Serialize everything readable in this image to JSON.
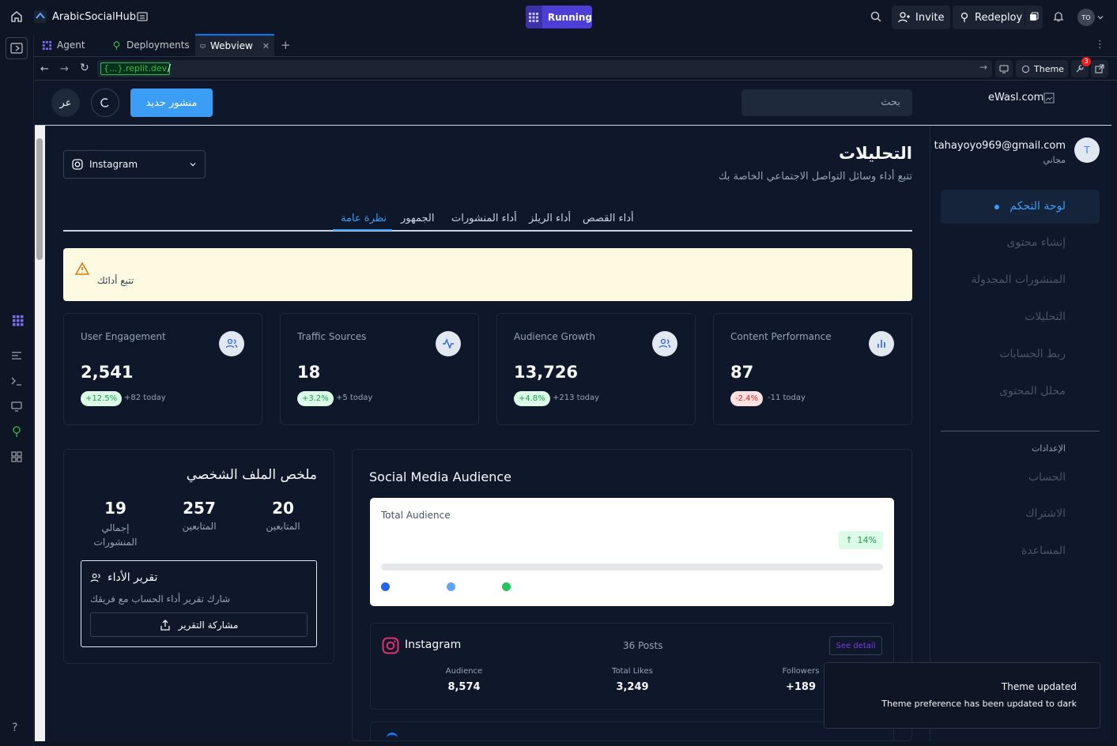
{
  "topbar": {
    "app_name": "ArabicSocialHub",
    "status": "Running",
    "invite": "Invite",
    "redeploy": "Redeploy",
    "avatar": "TO"
  },
  "tabs": [
    {
      "label": "Agent"
    },
    {
      "label": "Deployments"
    },
    {
      "label": "Webview"
    }
  ],
  "url": {
    "domain": "{...}.replit.dev",
    "path": "/",
    "theme": "Theme",
    "badge": "3"
  },
  "site": {
    "logo": "eWasl.com",
    "search_placeholder": "بحث",
    "new_post": "منشور جديد",
    "lang": "عر"
  },
  "user": {
    "email": "tahayoyo969@gmail.com",
    "plan": "مجاني",
    "initial": "T"
  },
  "sidebar": {
    "items": [
      {
        "label": "لوحة التحكم"
      },
      {
        "label": "إنشاء محتوى"
      },
      {
        "label": "المنشورات المجدولة"
      },
      {
        "label": "التحليلات"
      },
      {
        "label": "ربط الحسابات"
      },
      {
        "label": "محلل المحتوى"
      }
    ],
    "settings_title": "الإعدادات",
    "settings": [
      {
        "label": "الحساب"
      },
      {
        "label": "الاشتراك"
      },
      {
        "label": "المساعدة"
      }
    ]
  },
  "page": {
    "title": "التحليلات",
    "subtitle": "تتبع أداء وسائل التواصل الاجتماعي الخاصة بك",
    "platform": "Instagram"
  },
  "analytics_tabs": [
    {
      "label": "نظرة عامة"
    },
    {
      "label": "الجمهور"
    },
    {
      "label": "أداء المنشورات"
    },
    {
      "label": "أداء الريلز"
    },
    {
      "label": "أداء القصص"
    }
  ],
  "alert": {
    "text": "تتبع أدائك"
  },
  "stats": [
    {
      "title": "User Engagement",
      "value": "2,541",
      "change": "+12.5%",
      "today": "+82 today",
      "trend": "up"
    },
    {
      "title": "Traffic Sources",
      "value": "18",
      "change": "+3.2%",
      "today": "+5 today",
      "trend": "up"
    },
    {
      "title": "Audience Growth",
      "value": "13,726",
      "change": "+4.8%",
      "today": "+213 today",
      "trend": "up"
    },
    {
      "title": "Content Performance",
      "value": "87",
      "change": "-2.4%",
      "today": "-11 today",
      "trend": "down"
    }
  ],
  "profile": {
    "title": "ملخص الملف الشخصي",
    "stats": [
      {
        "value": "19",
        "label": "إجمالي المنشورات"
      },
      {
        "value": "257",
        "label": "المتابعين"
      },
      {
        "value": "20",
        "label": "المتابعين"
      }
    ],
    "report_title": "تقرير الأداء",
    "report_desc": "شارك تقرير أداء الحساب مع فريقك",
    "share": "مشاركة التقرير"
  },
  "audience": {
    "title": "Social Media Audience",
    "total_label": "Total Audience",
    "growth": "14%",
    "dot_colors": [
      "#2563eb",
      "#60a5fa",
      "#22c55e"
    ]
  },
  "instagram": {
    "name": "Instagram",
    "posts": "36 Posts",
    "detail": "See detail",
    "metrics": [
      {
        "label": "Audience",
        "value": "8,574"
      },
      {
        "label": "Total Likes",
        "value": "3,249"
      },
      {
        "label": "Followers",
        "value": "+189"
      }
    ]
  },
  "toast": {
    "title": "Theme updated",
    "body": "Theme preference has been updated to dark"
  }
}
